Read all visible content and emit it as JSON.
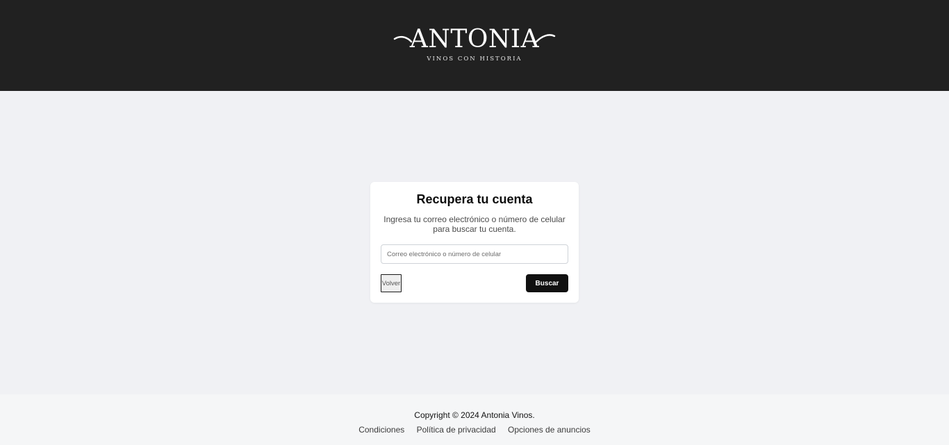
{
  "brand": {
    "name": "ANTONIA",
    "tagline": "VINOS CON HISTORIA"
  },
  "recovery": {
    "title": "Recupera tu cuenta",
    "description": "Ingresa tu correo electrónico o número de celular para buscar tu cuenta.",
    "input_placeholder": "Correo electrónico o número de celular",
    "input_value": "",
    "back_label": "Volver",
    "search_label": "Buscar"
  },
  "footer": {
    "copyright": "Copyright © 2024 Antonia Vinos.",
    "links": [
      "Condiciones",
      "Política de privacidad",
      "Opciones de anuncios"
    ]
  },
  "colors": {
    "header_bg": "#212121",
    "page_bg": "#f0f1f4",
    "button_primary": "#111111"
  }
}
